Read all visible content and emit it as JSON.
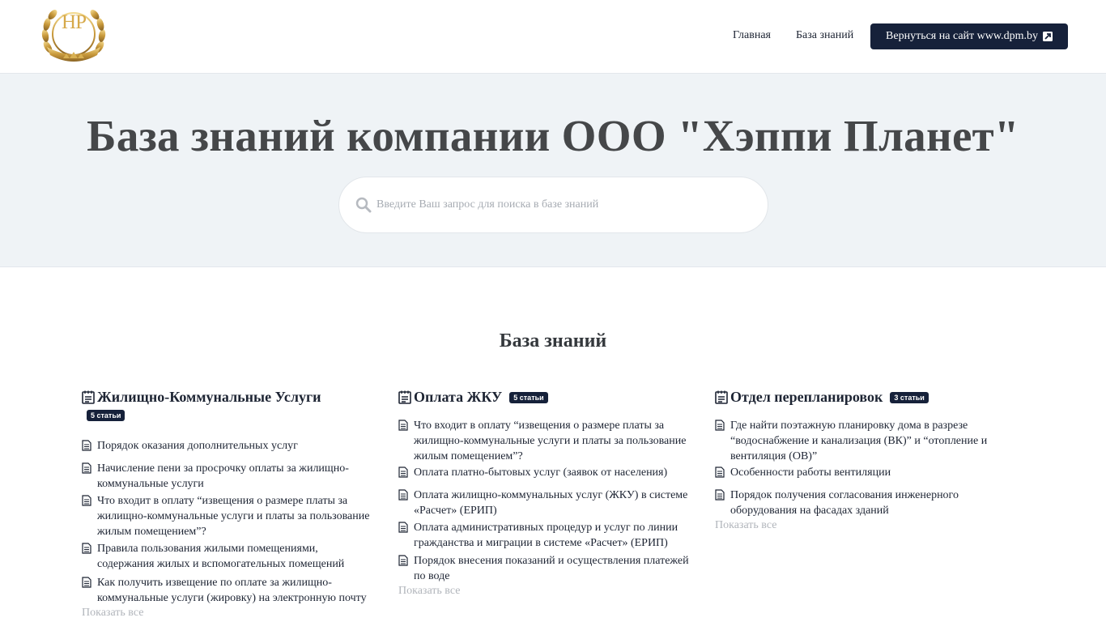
{
  "header": {
    "logo_text": "HP",
    "nav": {
      "home": "Главная",
      "kb": "База знаний"
    },
    "back_button": "Вернуться на сайт www.dpm.by"
  },
  "hero": {
    "title": "База знаний компании ООО \"Хэппи Планет\"",
    "search_placeholder": "Введите Ваш запрос для поиска в базе знаний"
  },
  "section_title": "База знаний",
  "categories": [
    {
      "title": "Жилищно-Коммунальные Услуги",
      "badge": "5 статьи",
      "articles": [
        "Порядок оказания дополнительных услуг",
        "Начисление пени за просрочку оплаты за жилищно-коммунальные услуги",
        "Что входит в оплату “извещения о размере платы за жилищно-коммунальные услуги и платы за пользование жилым помещением”?",
        "Правила пользования жилыми помещениями, содержания жилых и вспомогательных помещений",
        "Как получить извещение по оплате за жилищно-коммунальные услуги (жировку) на электронную почту"
      ],
      "show_all": "Показать все"
    },
    {
      "title": "Оплата ЖКУ",
      "badge": "5 статьи",
      "articles": [
        "Что входит в оплату “извещения о размере платы за жилищно-коммунальные услуги и платы за пользование жилым помещением”?",
        "Оплата платно-бытовых услуг (заявок от населения)",
        "Оплата жилищно-коммунальных услуг (ЖКУ) в системе «Расчет» (ЕРИП)",
        "Оплата административных процедур и услуг по линии гражданства и миграции в системе «Расчет» (ЕРИП)",
        "Порядок внесения показаний и осуществления платежей по воде"
      ],
      "show_all": "Показать все"
    },
    {
      "title": "Отдел перепланировок",
      "badge": "3 статьи",
      "articles": [
        "Где найти поэтажную планировку дома в разрезе “водоснабжение и канализация (ВК)” и “отопление и вентиляция (ОВ)”",
        "Особенности работы вентиляции",
        "Порядок получения согласования инженерного оборудования на фасадах зданий"
      ],
      "show_all": "Показать все"
    }
  ]
}
